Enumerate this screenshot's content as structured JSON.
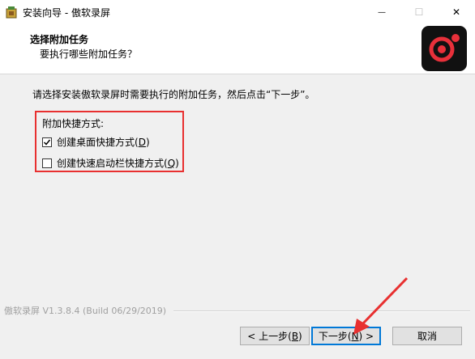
{
  "window": {
    "title": "安装向导 - 傲软录屏",
    "controls": {
      "minimize": "—",
      "maximize": "☐",
      "close": "✕"
    }
  },
  "header": {
    "title": "选择附加任务",
    "subtitle": "要执行哪些附加任务？",
    "logo_icon": "record-logo-icon"
  },
  "content": {
    "instruction": "请选择安装傲软录屏时需要执行的附加任务，然后点击“下一步”。",
    "group_label": "附加快捷方式:",
    "options": [
      {
        "label_pre": "创建桌面快捷方式(",
        "accel": "D",
        "label_post": ")",
        "checked": true
      },
      {
        "label_pre": "创建快速启动栏快捷方式(",
        "accel": "Q",
        "label_post": ")",
        "checked": false
      }
    ]
  },
  "footer": {
    "version": "傲软录屏 V1.3.8.4  (Build 06/29/2019)",
    "buttons": {
      "back": {
        "pre": "< 上一步(",
        "accel": "B",
        "post": ")"
      },
      "next": {
        "pre": "下一步(",
        "accel": "N",
        "post": ") >"
      },
      "cancel": "取消"
    }
  },
  "annotation": {
    "highlight_color": "#e83030"
  }
}
